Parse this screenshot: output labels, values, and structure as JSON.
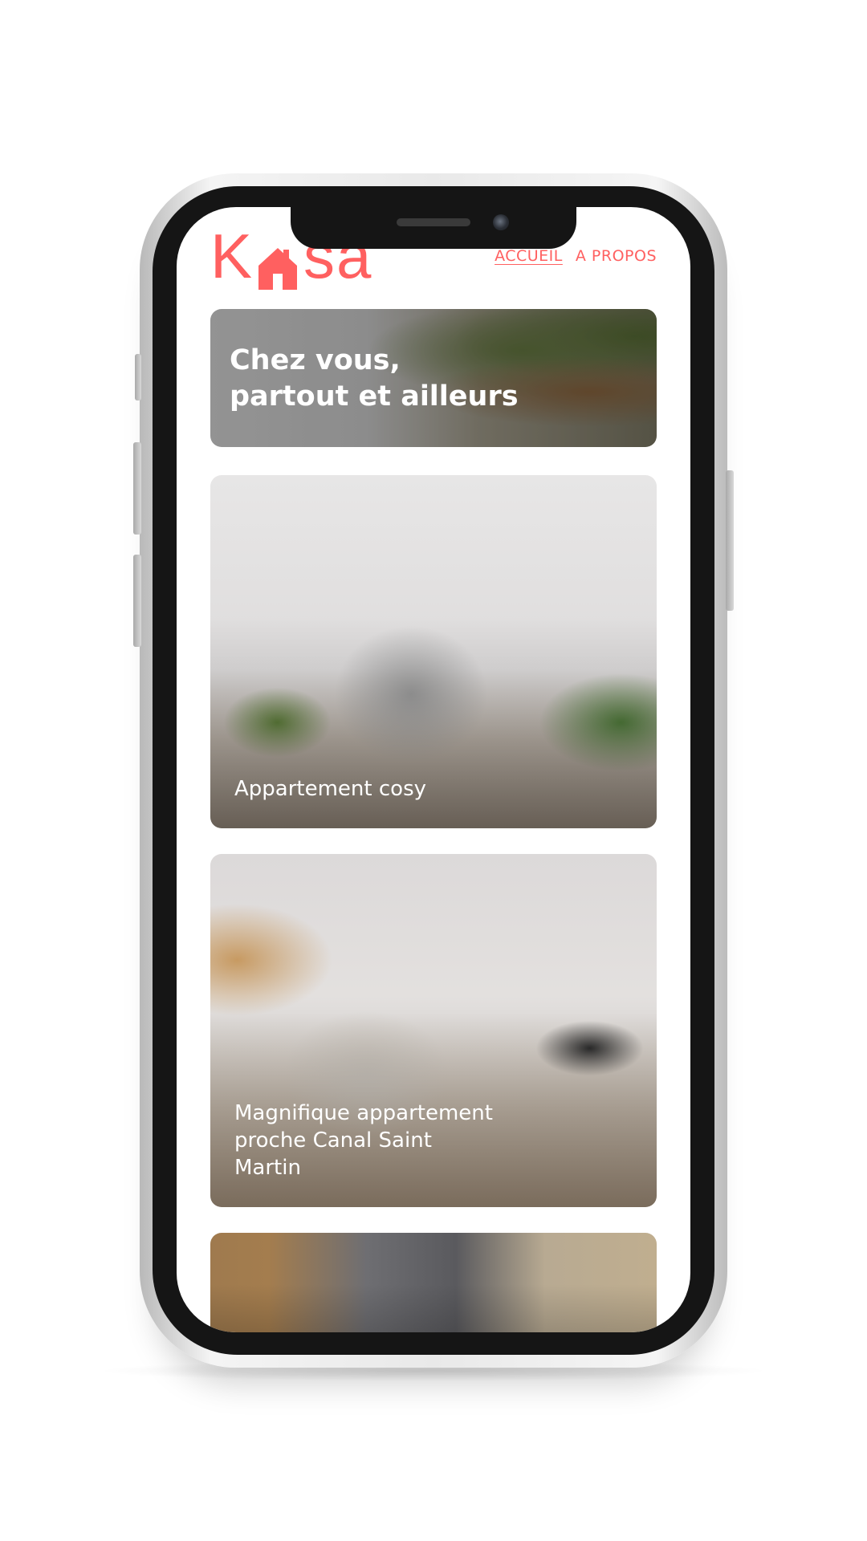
{
  "app": {
    "logo_text_left": "K",
    "logo_text_right": "sa",
    "brand_color": "#ff6060"
  },
  "nav": {
    "items": [
      {
        "label": "ACCUEIL",
        "active": true
      },
      {
        "label": "A PROPOS",
        "active": false
      }
    ]
  },
  "banner": {
    "title": "Chez vous,\npartout et ailleurs"
  },
  "cards": [
    {
      "title": "Appartement cosy"
    },
    {
      "title": "Magnifique appartement proche Canal Saint Martin"
    },
    {
      "title": ""
    }
  ],
  "icons": {
    "logo_icon": "house-icon",
    "camera": "front-camera-icon"
  }
}
